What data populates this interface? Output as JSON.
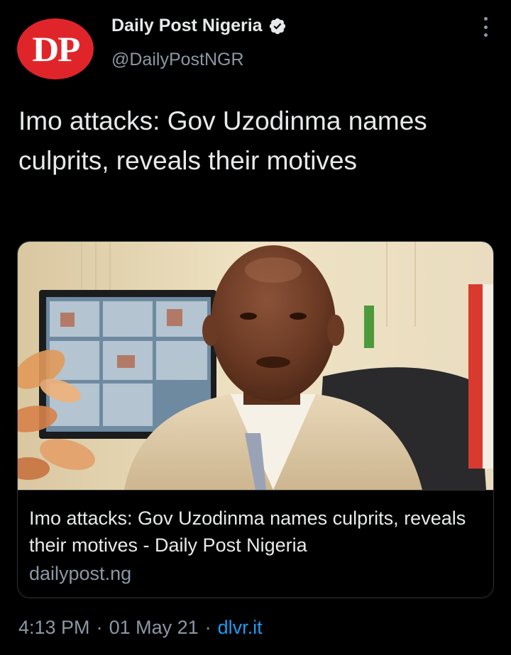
{
  "header": {
    "avatar_text": "DP",
    "display_name": "Daily Post Nigeria",
    "handle": "@DailyPostNGR",
    "verified_icon": "verified-badge-icon",
    "more_icon": "more-vertical-icon"
  },
  "tweet": {
    "text": "Imo attacks: Gov Uzodinma names culprits, reveals their motives"
  },
  "card": {
    "image_description_icon": "photo",
    "title": "Imo attacks: Gov Uzodinma names culprits, reveals their motives - Daily Post Nigeria",
    "domain": "dailypost.ng"
  },
  "meta": {
    "time": "4:13 PM",
    "separator": "·",
    "date": "01 May 21",
    "source": "dlvr.it"
  },
  "colors": {
    "background": "#000000",
    "primary_text": "#e7e9ea",
    "secondary_text": "#8b98a5",
    "link": "#1d9bf0",
    "brand_red": "#e0252a",
    "border": "#2f3336"
  }
}
